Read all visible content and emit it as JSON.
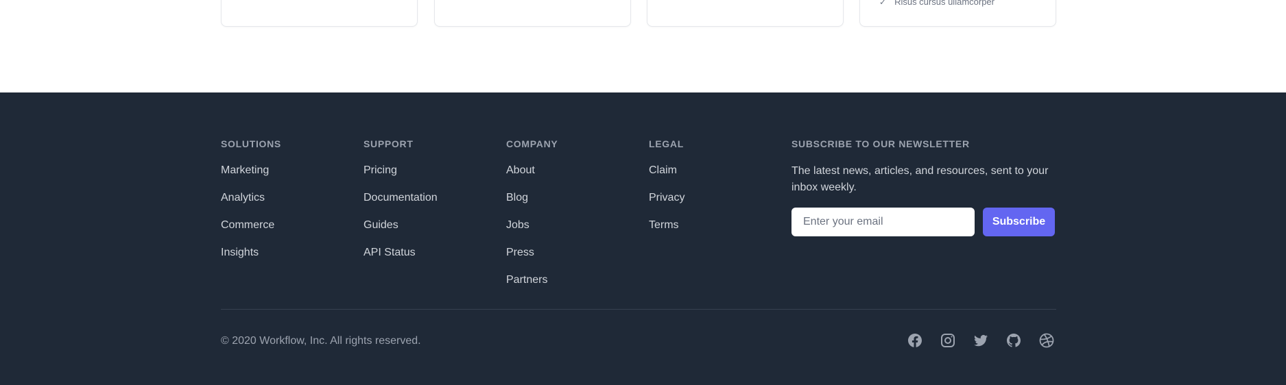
{
  "top_cards": {
    "card4_item": "Risus cursus ullamcorper"
  },
  "footer": {
    "columns": [
      {
        "heading": "Solutions",
        "links": [
          "Marketing",
          "Analytics",
          "Commerce",
          "Insights"
        ]
      },
      {
        "heading": "Support",
        "links": [
          "Pricing",
          "Documentation",
          "Guides",
          "API Status"
        ]
      },
      {
        "heading": "Company",
        "links": [
          "About",
          "Blog",
          "Jobs",
          "Press",
          "Partners"
        ]
      },
      {
        "heading": "Legal",
        "links": [
          "Claim",
          "Privacy",
          "Terms"
        ]
      }
    ],
    "newsletter": {
      "heading": "Subscribe to our newsletter",
      "description": "The latest news, articles, and resources, sent to your inbox weekly.",
      "email_placeholder": "Enter your email",
      "button_label": "Subscribe"
    },
    "copyright": "© 2020 Workflow, Inc. All rights reserved.",
    "socials": [
      "facebook-icon",
      "instagram-icon",
      "twitter-icon",
      "github-icon",
      "dribbble-icon"
    ]
  },
  "colors": {
    "footer_bg": "#1f2937",
    "accent": "#6366f1",
    "heading_text": "#9ca3af",
    "link_text": "#d1d5db"
  }
}
